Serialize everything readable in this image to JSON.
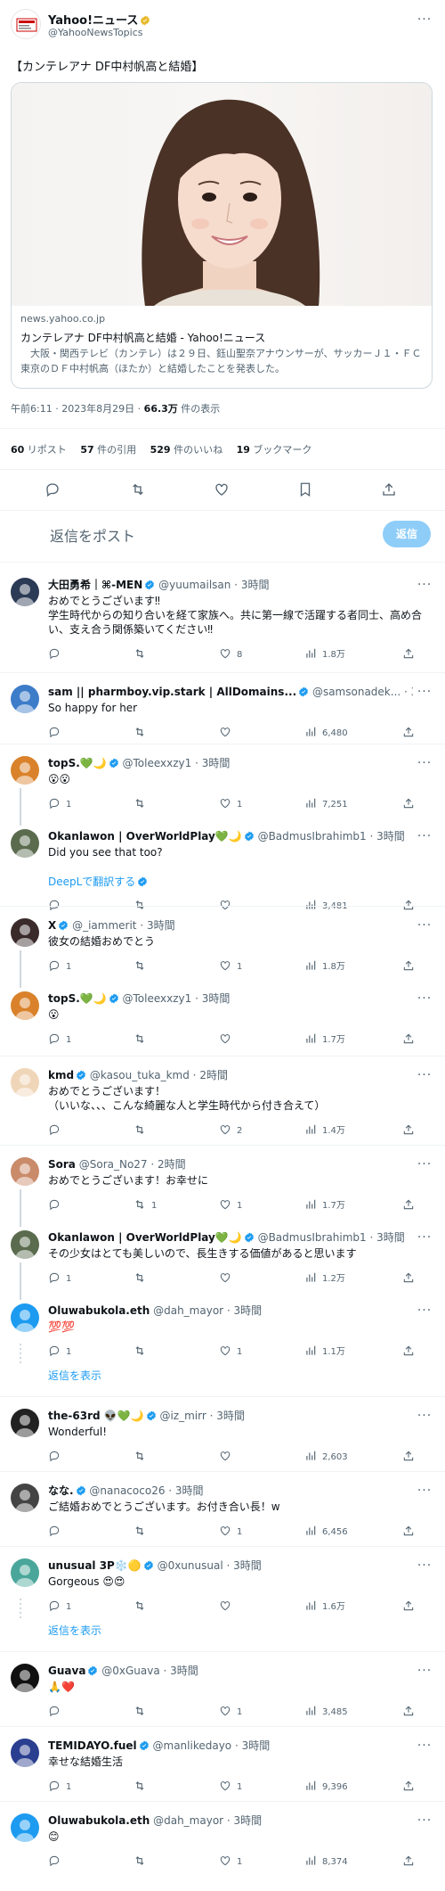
{
  "tweet": {
    "author_name": "Yahoo!ニュース",
    "author_handle": "@YahooNewsTopics",
    "text": "【カンテレアナ DF中村帆高と結婚】",
    "card": {
      "domain": "news.yahoo.co.jp",
      "title": "カンテレアナ DF中村帆高と結婚 - Yahoo!ニュース",
      "desc": "　大阪・関西テレビ（カンテレ）は２９日、鈺山聖奈アナウンサーが、サッカーＪ１・ＦＣ東京のＤＦ中村帆高（ほたか）と結婚したことを発表した。"
    },
    "time": "午前6:11 · 2023年8月29日 · ",
    "views_num": "66.3万",
    "views_label": " 件の表示",
    "stats": [
      {
        "num": "60",
        "label": " リポスト"
      },
      {
        "num": "57",
        "label": " 件の引用"
      },
      {
        "num": "529",
        "label": " 件のいいね"
      },
      {
        "num": "19",
        "label": " ブックマーク"
      }
    ]
  },
  "composer": {
    "placeholder": "返信をポスト",
    "button": "返信"
  },
  "replies": [
    {
      "name": "大田勇希｜⌘-MEN",
      "handle": "@yuumailsan",
      "time": "3時間",
      "text": "おめでとうございます‼︎\n学生時代からの知り合いを経て家族へ。共に第一線で活躍する者同士、高め合い、支え合う関係築いてください‼︎",
      "reply": "",
      "retweet": "",
      "like": "8",
      "views": "1.8万"
    },
    {
      "name": "sam || pharmboy.vip.stark | AllDomains...",
      "handle": "@samsonadek...",
      "time": "3時間",
      "text": "So happy for her",
      "reply": "",
      "retweet": "",
      "like": "",
      "views": "6,480"
    },
    {
      "name": "topS.💚🌙",
      "handle": "@Toleexxzy1",
      "time": "3時間",
      "text": "😮😮",
      "reply": "1",
      "retweet": "",
      "like": "1",
      "views": "7,251"
    },
    {
      "name": "Okanlawon | OverWorldPlay💚🌙",
      "handle": "@BadmusIbrahimb1",
      "time": "3時間",
      "text": "Did you see that too?",
      "translate": "DeepLで翻訳する",
      "reply": "",
      "retweet": "",
      "like": "",
      "views": "3,481"
    },
    {
      "name": "X",
      "handle": "@_iammerit",
      "time": "3時間",
      "text": "彼女の結婚おめでとう",
      "reply": "1",
      "retweet": "",
      "like": "1",
      "views": "1.8万"
    },
    {
      "name": "topS.💚🌙",
      "handle": "@Toleexxzy1",
      "time": "3時間",
      "text": "😮",
      "reply": "1",
      "retweet": "",
      "like": "",
      "views": "1.7万"
    },
    {
      "name": "kmd",
      "handle": "@kasou_tuka_kmd",
      "time": "2時間",
      "text": "おめでとうございます！\n（いいな、、、こんな綺麗な人と学生時代から付き合えて）",
      "reply": "",
      "retweet": "",
      "like": "2",
      "views": "1.4万"
    },
    {
      "name": "Sora",
      "handle": "@Sora_No27",
      "time": "2時間",
      "text": "おめでとうございます！お幸せに",
      "reply": "",
      "retweet": "1",
      "like": "1",
      "views": "1.7万"
    },
    {
      "name": "Okanlawon | OverWorldPlay💚🌙",
      "handle": "@BadmusIbrahimb1",
      "time": "3時間",
      "text": "その少女はとても美しいので、長生きする価値があると思います",
      "reply": "1",
      "retweet": "",
      "like": "",
      "views": "1.2万"
    },
    {
      "name": "Oluwabukola.eth",
      "handle": "@dah_mayor",
      "time": "3時間",
      "text": "💯💯",
      "reply": "1",
      "retweet": "",
      "like": "1",
      "views": "1.1万"
    },
    {
      "name": "the-63rd 👽💚🌙",
      "handle": "@iz_mirr",
      "time": "3時間",
      "text": "Wonderful!",
      "reply": "",
      "retweet": "",
      "like": "",
      "views": "2,603"
    },
    {
      "name": "なな.",
      "handle": "@nanacoco26",
      "time": "3時間",
      "text": "ご結婚おめでとうございます。お付き合い長！w",
      "reply": "",
      "retweet": "",
      "like": "1",
      "views": "6,456"
    },
    {
      "name": "unusual 3P❄️🟡",
      "handle": "@0xunusual",
      "time": "3時間",
      "text": "Gorgeous 😍😍",
      "reply": "1",
      "retweet": "",
      "like": "",
      "views": "1.6万"
    },
    {
      "name": "Guava",
      "handle": "@0xGuava",
      "time": "3時間",
      "text": "🙏❤️",
      "reply": "",
      "retweet": "",
      "like": "1",
      "views": "3,485"
    },
    {
      "name": "TEMIDAYO.fuel",
      "handle": "@manlikedayo",
      "time": "3時間",
      "text": "幸せな結婚生活",
      "reply": "1",
      "retweet": "",
      "like": "1",
      "views": "9,396"
    },
    {
      "name": "Oluwabukola.eth",
      "handle": "@dah_mayor",
      "time": "3時間",
      "text": "😊",
      "reply": "",
      "retweet": "",
      "like": "1",
      "views": "8,374"
    }
  ],
  "show_replies_label": "返信を表示",
  "colors": {
    "accent": "#1d9bf0",
    "text": "#0f1419",
    "muted": "#536471",
    "border": "#eff3f4"
  }
}
